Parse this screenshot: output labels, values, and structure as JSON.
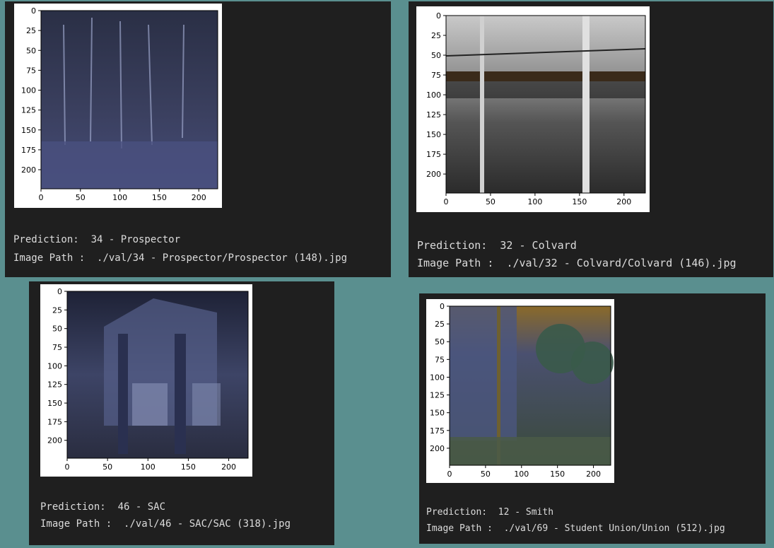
{
  "colors": {
    "background": "#5a8f8f",
    "panel": "#1f1f1f",
    "text": "#dcdcdc",
    "card": "#ffffff"
  },
  "outputs": [
    {
      "name": "prospector",
      "image_description": "dark blue-tinted courtyard with trees and outdoor seating",
      "x_ticks": [
        "0",
        "50",
        "100",
        "150",
        "200"
      ],
      "y_ticks": [
        "0",
        "25",
        "50",
        "75",
        "100",
        "125",
        "150",
        "175",
        "200"
      ],
      "prediction_label": "Prediction:",
      "prediction_value": "34 - Prospector",
      "path_label": "Image Path :",
      "path_value": "./val/34 - Prospector/Prospector (148).jpg"
    },
    {
      "name": "colvard",
      "image_description": "interior atrium with steel columns and glass roof",
      "x_ticks": [
        "0",
        "50",
        "100",
        "150",
        "200"
      ],
      "y_ticks": [
        "0",
        "25",
        "50",
        "75",
        "100",
        "125",
        "150",
        "175",
        "200"
      ],
      "prediction_label": "Prediction:",
      "prediction_value": "32 - Colvard",
      "path_label": "Image Path :",
      "path_value": "./val/32 - Colvard/Colvard (146).jpg"
    },
    {
      "name": "sac",
      "image_description": "building entrance at night with tall columns",
      "x_ticks": [
        "0",
        "50",
        "100",
        "150",
        "200"
      ],
      "y_ticks": [
        "0",
        "25",
        "50",
        "75",
        "100",
        "125",
        "150",
        "175",
        "200"
      ],
      "prediction_label": "Prediction:",
      "prediction_value": "46 - SAC",
      "path_label": "Image Path :",
      "path_value": "./val/46 - SAC/SAC (318).jpg"
    },
    {
      "name": "smith",
      "image_description": "brick building beside trees with orange-tinted sky",
      "x_ticks": [
        "0",
        "50",
        "100",
        "150",
        "200"
      ],
      "y_ticks": [
        "0",
        "25",
        "50",
        "75",
        "100",
        "125",
        "150",
        "175",
        "200"
      ],
      "prediction_label": "Prediction:",
      "prediction_value": "12 - Smith",
      "path_label": "Image Path :",
      "path_value": "./val/69 - Student Union/Union (512).jpg"
    }
  ]
}
